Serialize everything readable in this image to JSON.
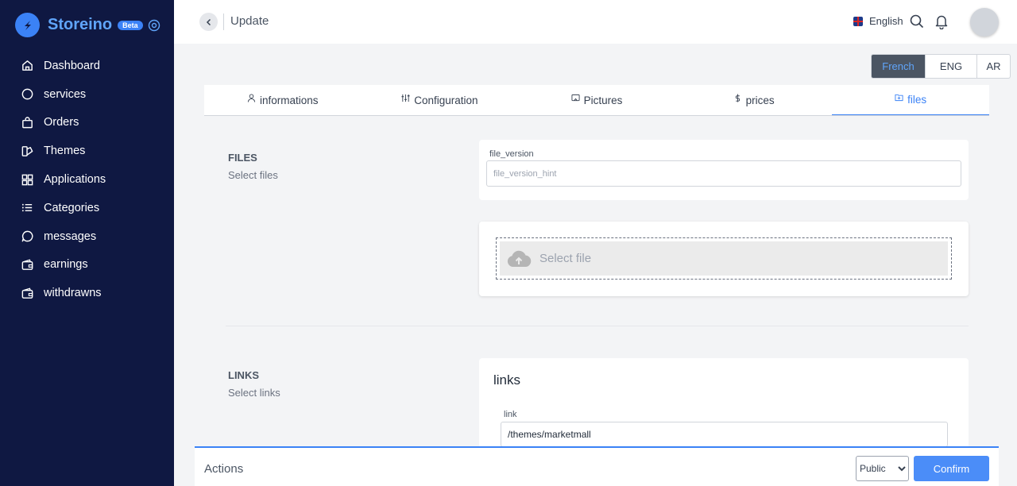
{
  "sidebar": {
    "brand": {
      "name": "Storeino",
      "badge": "Beta"
    },
    "items": [
      {
        "label": "Dashboard",
        "icon": "home-icon"
      },
      {
        "label": "services",
        "icon": "circle-icon"
      },
      {
        "label": "Orders",
        "icon": "shopping-bag-icon"
      },
      {
        "label": "Themes",
        "icon": "palette-icon"
      },
      {
        "label": "Applications",
        "icon": "grid-icon"
      },
      {
        "label": "Categories",
        "icon": "list-icon"
      },
      {
        "label": "messages",
        "icon": "chat-bubble-icon"
      },
      {
        "label": "earnings",
        "icon": "wallet-icon"
      },
      {
        "label": "withdrawns",
        "icon": "wallet-icon"
      }
    ]
  },
  "header": {
    "title": "Update",
    "language": "English"
  },
  "language_switch": {
    "options": [
      "French",
      "ENG",
      "AR"
    ],
    "active": "French"
  },
  "tabs": [
    {
      "label": "informations",
      "icon": "user-icon"
    },
    {
      "label": "Configuration",
      "icon": "sliders-icon"
    },
    {
      "label": "Pictures",
      "icon": "image-icon"
    },
    {
      "label": "prices",
      "icon": "dollar-icon"
    },
    {
      "label": "files",
      "icon": "folder-plus-icon"
    }
  ],
  "active_tab": "files",
  "files_section": {
    "title": "FILES",
    "subtitle": "Select files",
    "file_version_label": "file_version",
    "file_version_placeholder": "file_version_hint",
    "dropzone_text": "Select file"
  },
  "links_section": {
    "title": "LINKS",
    "subtitle": "Select links",
    "heading": "links",
    "link_label": "link",
    "link_value": "/themes/marketmall"
  },
  "actions": {
    "label": "Actions",
    "visibility": "Public",
    "confirm": "Confirm"
  },
  "colors": {
    "sidebar_bg": "#0f1842",
    "accent": "#3b82f6"
  }
}
